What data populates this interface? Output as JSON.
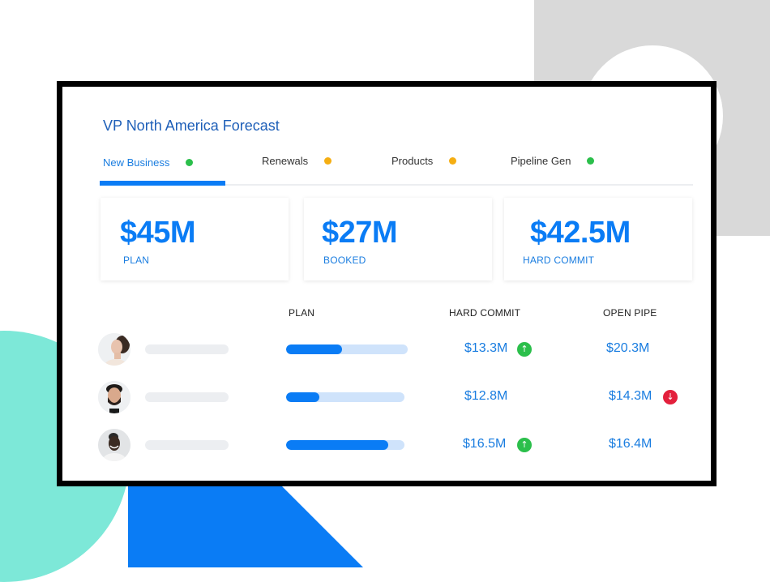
{
  "app": {
    "title": "VP North America Forecast"
  },
  "tabs": [
    {
      "label": "New Business",
      "status_color": "#2bbf4b",
      "active": true
    },
    {
      "label": "Renewals",
      "status_color": "#f5ae12",
      "active": false
    },
    {
      "label": "Products",
      "status_color": "#f5ae12",
      "active": false
    },
    {
      "label": "Pipeline Gen",
      "status_color": "#2bbf4b",
      "active": false
    }
  ],
  "summary_cards": [
    {
      "value": "$45M",
      "label": "PLAN"
    },
    {
      "value": "$27M",
      "label": "BOOKED"
    },
    {
      "value": "$42.5M",
      "label": "HARD COMMIT"
    }
  ],
  "table": {
    "columns": [
      "PLAN",
      "HARD COMMIT",
      "OPEN PIPE"
    ],
    "rows": [
      {
        "avatar": "avatar-woman",
        "plan_progress": 0.46,
        "hard_commit": "$13.3M",
        "hard_commit_trend": "up",
        "open_pipe": "$20.3M",
        "open_pipe_trend": null
      },
      {
        "avatar": "avatar-bearded-man",
        "plan_progress": 0.28,
        "hard_commit": "$12.8M",
        "hard_commit_trend": null,
        "open_pipe": "$14.3M",
        "open_pipe_trend": "down"
      },
      {
        "avatar": "avatar-smiling-man",
        "plan_progress": 0.86,
        "hard_commit": "$16.5M",
        "hard_commit_trend": "up",
        "open_pipe": "$16.4M",
        "open_pipe_trend": null
      }
    ]
  },
  "icons": {
    "trend_up": "↑",
    "trend_down": "↓"
  },
  "colors": {
    "accent": "#0a7cf5",
    "title": "#1e5fb8",
    "positive": "#2bbf4b",
    "negative": "#e3203c",
    "warning": "#f5ae12"
  }
}
